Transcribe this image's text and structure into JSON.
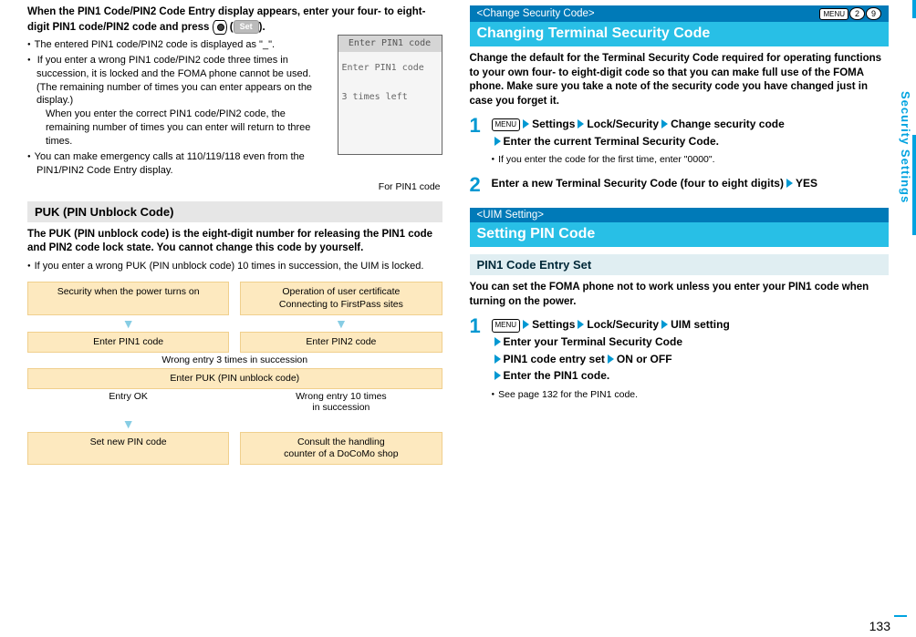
{
  "left": {
    "lead1": "When the PIN1 Code/PIN2 Code Entry display appears, enter your four- to eight-digit PIN1 code/PIN2 code and press ",
    "lead2": "(",
    "set_button_label": "Set",
    "lead3": ").",
    "bullets": [
      "The entered PIN1 code/PIN2 code is displayed as \"_\".",
      "If you enter a wrong PIN1 code/PIN2 code three times in succession, it is locked and the FOMA phone cannot be used. (The remaining number of times you can enter appears on the display.)",
      "You can make emergency calls at 110/119/118 even from the PIN1/PIN2 Code Entry display."
    ],
    "bullet2_sub": "When you enter the correct PIN1 code/PIN2 code, the remaining number of times you can enter will return to three times.",
    "screenshot": {
      "title": "Enter PIN1 code",
      "line1": "Enter PIN1 code",
      "line2": "3 times left",
      "caption": "For PIN1 code"
    },
    "puk": {
      "heading": "PUK (PIN Unblock Code)",
      "intro": "The PUK (PIN unblock code) is the eight-digit number for releasing the PIN1 code and PIN2 code lock state. You cannot change this code by yourself.",
      "bullet": "If you enter a wrong PUK (PIN unblock code) 10 times in succession, the UIM is locked."
    },
    "flow": {
      "top_left": "Security when the power turns on",
      "top_right_l1": "Operation of user certificate",
      "top_right_l2": "Connecting to FirstPass sites",
      "mid_left": "Enter PIN1 code",
      "mid_right": "Enter PIN2 code",
      "wrong3": "Wrong entry 3 times in succession",
      "puk_box": "Enter PUK (PIN unblock code)",
      "entry_ok": "Entry OK",
      "wrong10_l1": "Wrong entry 10 times",
      "wrong10_l2": "in succession",
      "set_new": "Set new PIN code",
      "consult_l1": "Consult the handling",
      "consult_l2": "counter of a DoCoMo shop"
    }
  },
  "right": {
    "change_security": {
      "tag": "<Change Security Code>",
      "menu_label": "MENU",
      "digit1": "2",
      "digit2": "9",
      "title": "Changing Terminal Security Code",
      "intro": "Change the default for the Terminal Security Code required for operating functions to your own four- to eight-digit code so that you can make full use of the FOMA phone. Make sure you take a note of the security code you have changed just in case you forget it.",
      "step1_parts": [
        "Settings",
        "Lock/Security",
        "Change security code",
        "Enter the current Terminal Security Code."
      ],
      "step1_note": "If you enter the code for the first time, enter \"0000\".",
      "step2_l1": "Enter a new Terminal Security Code (four to eight digits)",
      "step2_l2": "YES"
    },
    "uim": {
      "tag": "<UIM Setting>",
      "title": "Setting PIN Code",
      "subheading": "PIN1 Code Entry Set",
      "intro": "You can set the FOMA phone not to work unless you enter your PIN1 code when turning on the power.",
      "step1_parts": [
        "Settings",
        "Lock/Security",
        "UIM setting",
        "Enter your Terminal Security Code",
        "PIN1 code entry set",
        "ON or OFF",
        "Enter the PIN1 code."
      ],
      "step1_note": "See page 132 for the PIN1 code."
    }
  },
  "side_tab": "Security Settings",
  "page_number": "133"
}
